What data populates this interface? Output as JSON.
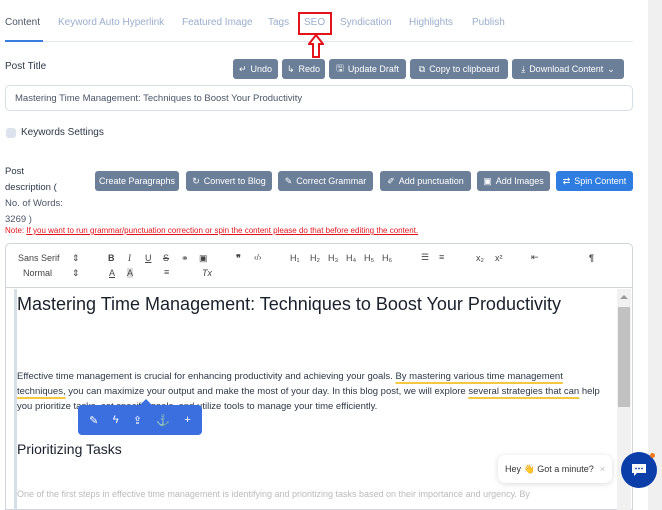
{
  "tabs": [
    {
      "label": "Content",
      "active": true
    },
    {
      "label": "Keyword Auto Hyperlink"
    },
    {
      "label": "Featured Image"
    },
    {
      "label": "Tags"
    },
    {
      "label": "SEO",
      "highlighted": true
    },
    {
      "label": "Syndication"
    },
    {
      "label": "Highlights"
    },
    {
      "label": "Publish"
    }
  ],
  "post_title": {
    "label": "Post Title",
    "value": "Mastering Time Management: Techniques to Boost Your Productivity"
  },
  "title_actions": {
    "undo": "Undo",
    "redo": "Redo",
    "update_draft": "Update Draft",
    "copy": "Copy to clipboard",
    "download": "Download Content"
  },
  "keywords": {
    "label": "Keywords Settings"
  },
  "description": {
    "label_1": "Post",
    "label_2": "description (",
    "label_3": "No. of Words:",
    "label_4": "3269 )"
  },
  "desc_actions": {
    "create_paragraphs": "Create Paragraphs",
    "convert_blog": "Convert to Blog",
    "correct_grammar": "Correct Grammar",
    "add_punctuation": "Add punctuation",
    "add_images": "Add Images",
    "spin_content": "Spin Content"
  },
  "note": {
    "prefix": "Note:",
    "text": "If you want to run grammar/punctuation correction or spin the content please do that before editing the content."
  },
  "toolbar": {
    "font": "Sans Serif",
    "size": "Normal"
  },
  "editor": {
    "heading": "Mastering Time Management: Techniques to Boost Your Productivity",
    "para_a": "Effective time management is crucial for enhancing productivity and achieving your goals. ",
    "para_ul1": "By mastering various time management techniques,",
    "para_b": " you can maximize your output and make the most of your day. In this blog post, we will explore ",
    "para_ul2": "several strategies that can",
    "para_c": " help you prioritize tasks, set specific goals, and utilize tools to manage your time efficiently.",
    "subheading": "Prioritizing Tasks",
    "para2": "One of the first steps in effective time management is identifying and prioritizing tasks based on their importance and urgency. By"
  },
  "chat": {
    "message": "Hey 👋 Got a minute?",
    "close": "×"
  },
  "colors": {
    "accent": "#3b7ddd",
    "button_gray": "#6b7f99",
    "button_blue": "#2f7de1",
    "note_red": "#e3131c",
    "chat_blue": "#0b3ea8"
  }
}
